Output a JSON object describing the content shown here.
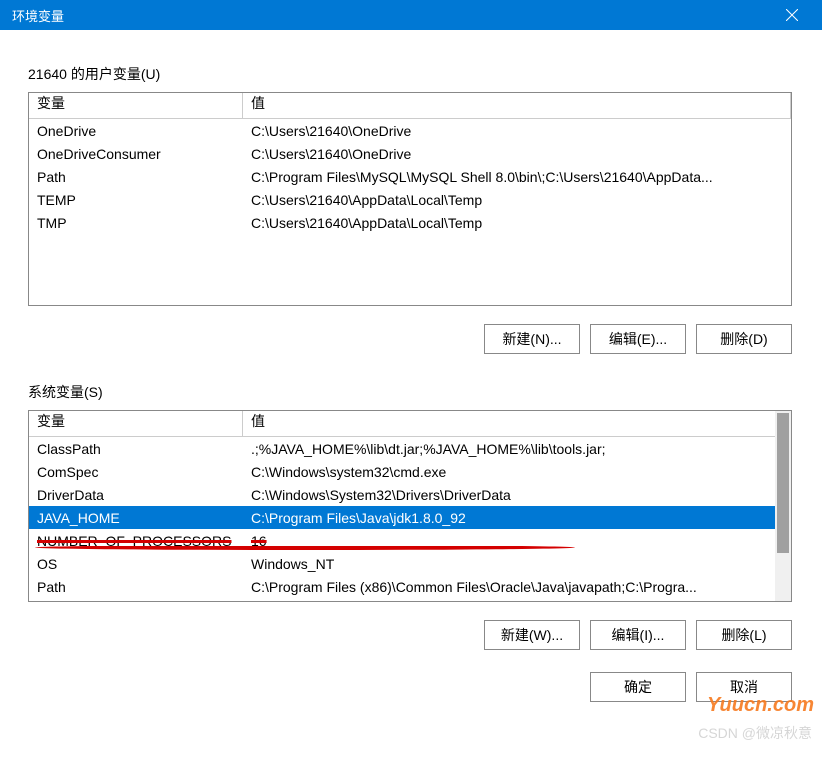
{
  "titlebar": {
    "title": "环境变量"
  },
  "user_section": {
    "label": "21640 的用户变量(U)",
    "header_var": "变量",
    "header_val": "值",
    "rows": [
      {
        "var": "OneDrive",
        "val": "C:\\Users\\21640\\OneDrive"
      },
      {
        "var": "OneDriveConsumer",
        "val": "C:\\Users\\21640\\OneDrive"
      },
      {
        "var": "Path",
        "val": "C:\\Program Files\\MySQL\\MySQL Shell 8.0\\bin\\;C:\\Users\\21640\\AppData..."
      },
      {
        "var": "TEMP",
        "val": "C:\\Users\\21640\\AppData\\Local\\Temp"
      },
      {
        "var": "TMP",
        "val": "C:\\Users\\21640\\AppData\\Local\\Temp"
      }
    ],
    "btn_new": "新建(N)...",
    "btn_edit": "编辑(E)...",
    "btn_del": "删除(D)"
  },
  "sys_section": {
    "label": "系统变量(S)",
    "header_var": "变量",
    "header_val": "值",
    "rows": [
      {
        "var": "ClassPath",
        "val": ".;%JAVA_HOME%\\lib\\dt.jar;%JAVA_HOME%\\lib\\tools.jar;",
        "sel": false
      },
      {
        "var": "ComSpec",
        "val": "C:\\Windows\\system32\\cmd.exe",
        "sel": false
      },
      {
        "var": "DriverData",
        "val": "C:\\Windows\\System32\\Drivers\\DriverData",
        "sel": false
      },
      {
        "var": "JAVA_HOME",
        "val": "C:\\Program Files\\Java\\jdk1.8.0_92",
        "sel": true
      },
      {
        "var": "NUMBER_OF_PROCESSORS",
        "val": "16",
        "sel": false,
        "strike": true
      },
      {
        "var": "OS",
        "val": "Windows_NT",
        "sel": false
      },
      {
        "var": "Path",
        "val": "C:\\Program Files (x86)\\Common Files\\Oracle\\Java\\javapath;C:\\Progra...",
        "sel": false
      }
    ],
    "btn_new": "新建(W)...",
    "btn_edit": "编辑(I)...",
    "btn_del": "删除(L)"
  },
  "main_buttons": {
    "ok": "确定",
    "cancel": "取消"
  },
  "watermark1": "Yuucn.com",
  "watermark2": "CSDN @微凉秋意"
}
